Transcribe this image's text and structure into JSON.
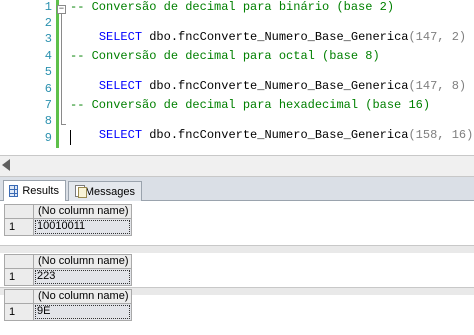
{
  "editor": {
    "line_numbers": [
      "1",
      "2",
      "3",
      "4",
      "5",
      "6",
      "7",
      "8",
      "9"
    ],
    "outline_glyph": "−",
    "lines": [
      {
        "comment": "-- Conversão de decimal para binário (base 2)"
      },
      {
        "kw": "SELECT",
        "text": " dbo.fncConverte_Numero_Base_Generica",
        "args": "(147, 2)"
      },
      {},
      {
        "comment": "-- Conversão de decimal para octal (base 8)"
      },
      {
        "kw": "SELECT",
        "text": " dbo.fncConverte_Numero_Base_Generica",
        "args": "(147, 8)"
      },
      {},
      {
        "comment": "-- Conversão de decimal para hexadecimal (base 16)"
      },
      {
        "kw": "SELECT",
        "text": " dbo.fncConverte_Numero_Base_Generica",
        "args": "(158, 16)"
      },
      {}
    ]
  },
  "tabs": {
    "results_label": "Results",
    "messages_label": "Messages"
  },
  "results": [
    {
      "column": "(No column name)",
      "row": "1",
      "value": "10010011"
    },
    {
      "column": "(No column name)",
      "row": "1",
      "value": "223"
    },
    {
      "column": "(No column name)",
      "row": "1",
      "value": "9E"
    }
  ],
  "colors": {
    "comment": "#008000",
    "keyword": "#0000ff",
    "line_number": "#2b91af",
    "change_bar": "#5ec04a"
  }
}
